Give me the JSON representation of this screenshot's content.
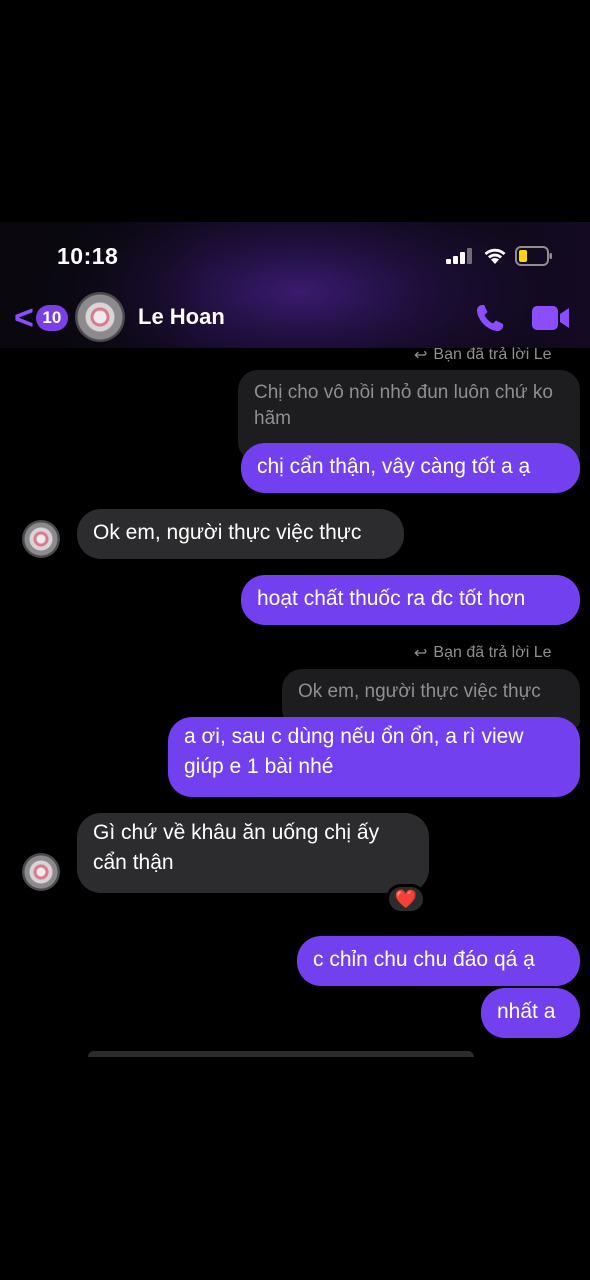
{
  "status_bar": {
    "time": "10:18"
  },
  "header": {
    "back_count": "10",
    "contact_name": "Le Hoan",
    "back_chevron": "<"
  },
  "icons": {
    "signal": "signal-icon",
    "wifi": "wifi-icon",
    "battery": "battery-icon",
    "phone": "phone-icon",
    "video": "video-camera-icon",
    "reply": "reply-arrow-icon",
    "heart": "heart-reaction-icon"
  },
  "colors": {
    "accent": "#7340f0",
    "incoming_bubble": "#2c2c2e",
    "background": "#000000"
  },
  "messages": [
    {
      "type": "reply_label",
      "text": "Bạn đã trả lời Le"
    },
    {
      "type": "quoted",
      "text": "Chị cho vô nồi nhỏ đun luôn chứ ko hãm"
    },
    {
      "type": "outgoing",
      "text": "chị cẩn thận, vây càng tốt a ạ"
    },
    {
      "type": "incoming",
      "text": "Ok em, người thực việc thực"
    },
    {
      "type": "outgoing",
      "text": "hoạt chất thuốc ra đc tốt hơn"
    },
    {
      "type": "reply_label",
      "text": "Bạn đã trả lời Le"
    },
    {
      "type": "quoted",
      "text": "Ok em, người thực việc thực"
    },
    {
      "type": "outgoing",
      "text": "a ơi, sau c dùng nếu ổn ổn, a rì view giúp e 1 bài nhé"
    },
    {
      "type": "incoming",
      "text": "Gì chứ về khâu ăn uống chị ấy cẩn thận",
      "reaction": "❤️"
    },
    {
      "type": "outgoing",
      "text": "c chỉn chu chu đáo qá ạ"
    },
    {
      "type": "outgoing",
      "text": "nhất a"
    }
  ]
}
